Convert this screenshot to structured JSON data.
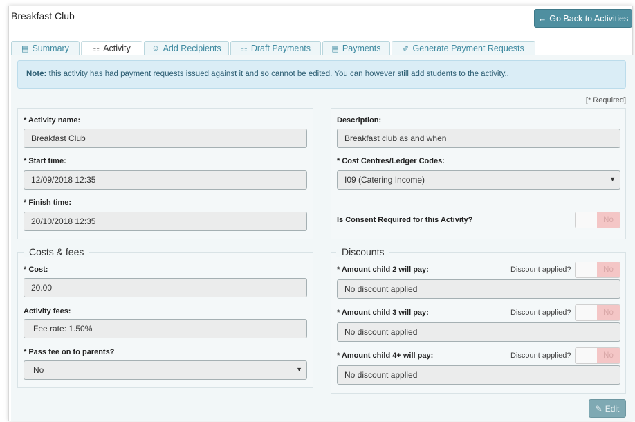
{
  "header": {
    "title": "Breakfast Club",
    "back_button": "Go Back to Activities"
  },
  "tabs": [
    {
      "label": "Summary",
      "icon": "book-icon"
    },
    {
      "label": "Activity",
      "icon": "list-icon",
      "active": true
    },
    {
      "label": "Add Recipients",
      "icon": "users-icon"
    },
    {
      "label": "Draft Payments",
      "icon": "list-icon"
    },
    {
      "label": "Payments",
      "icon": "book-icon"
    },
    {
      "label": "Generate Payment Requests",
      "icon": "paperclip-icon"
    }
  ],
  "note": {
    "prefix": "Note:",
    "text": "this activity has had payment requests issued against it and so cannot be edited. You can however still add students to the activity.."
  },
  "required_hint": "[* Required]",
  "activity": {
    "name_label": "* Activity name:",
    "name_value": "Breakfast Club",
    "start_label": "* Start time:",
    "start_value": "12/09/2018 12:35",
    "finish_label": "* Finish time:",
    "finish_value": "20/10/2018 12:35",
    "description_label": "Description:",
    "description_value": "Breakfast club as and when",
    "cost_centre_label": "* Cost Centres/Ledger Codes:",
    "cost_centre_value": "I09 (Catering Income)",
    "consent_label": "Is Consent Required for this Activity?",
    "consent_value": "No"
  },
  "costs": {
    "legend": "Costs & fees",
    "cost_label": "* Cost:",
    "cost_value": "20.00",
    "fees_label": "Activity fees:",
    "fees_value": "Fee rate: 1.50%",
    "pass_fee_label": "* Pass fee on to parents?",
    "pass_fee_value": "No"
  },
  "discounts": {
    "legend": "Discounts",
    "question": "Discount applied?",
    "items": [
      {
        "label": "* Amount child 2 will pay:",
        "value": "No discount applied",
        "toggle": "No"
      },
      {
        "label": "* Amount child 3 will pay:",
        "value": "No discount applied",
        "toggle": "No"
      },
      {
        "label": "* Amount child 4+ will pay:",
        "value": "No discount applied",
        "toggle": "No"
      }
    ]
  },
  "edit_button": "Edit",
  "colors": {
    "accent": "#4f8fa0",
    "note_bg": "#daedf6",
    "toggle_off": "#f4c6c6"
  }
}
